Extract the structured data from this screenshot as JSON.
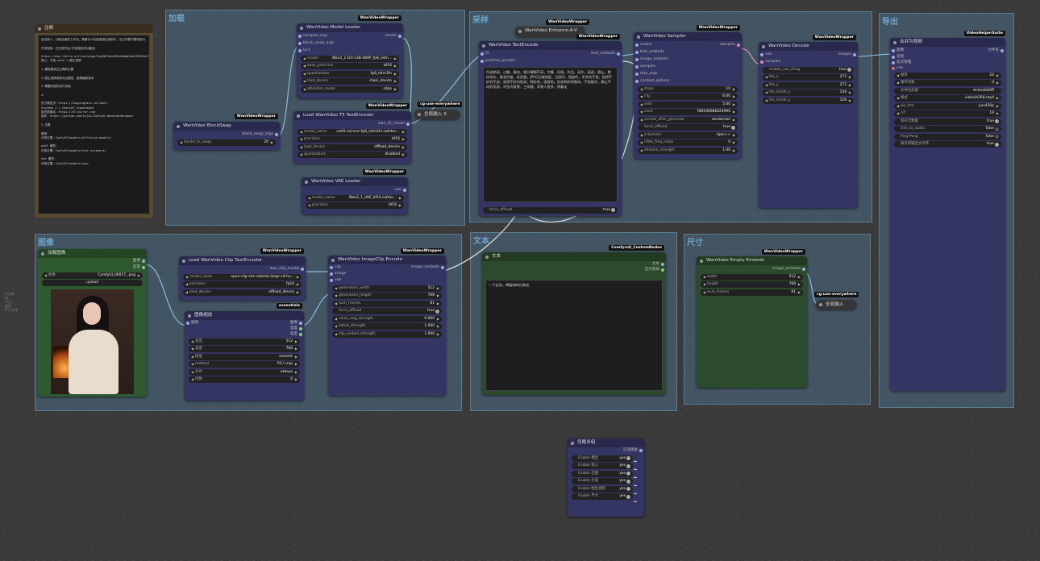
{
  "groups": [
    {
      "id": "g1",
      "title": "加载"
    },
    {
      "id": "g2",
      "title": "采样"
    },
    {
      "id": "g3",
      "title": "图像"
    },
    {
      "id": "g4",
      "title": "文本"
    },
    {
      "id": "g5",
      "title": "尺寸"
    },
    {
      "id": "g6",
      "title": "导出"
    }
  ],
  "note": {
    "title": "注释",
    "text": "适合新人，功能全面的工作流，需要什么功能直接启用即可，自己折叠不要的部分\n\n开关面板：在左侧开启/关闭相应的功能组\n\nhttps://www.liblib.art/userpage/2ad3621ba8934da0ab1bb5935b3d1f5c/publish/workflow\n核心：万相 wan2.1 图生视频\n\n1.模型要放在正确的位置\n\n2.图生视频选择对应模型，都是最新版本\n\n3.需要的插件自行安装\n\n4.\n\n官方模型页：https://huggingface.co/Comfy-Org/Wan_2.1_ComfyUI_repackaged\n国内镜像站：https://hf-mirror.com\n插件：https://github.com/kijai/ComfyUI-WanVideoWrapper\n\n5.位置\n\n模型:\n存放位置：ComfyUI/models/diffusion_models/\n\numt5 模型:\n存放位置：ComfyUI/models/text_encoders/\n\nVae 模型:\n存放位置：ComfyUI/models/vae/"
  },
  "model_loader": {
    "badge": "WanVideoWrapper",
    "title": "WanVideo Model Loader",
    "inputs": [
      "compile_args",
      "block_swap_args",
      "lora"
    ],
    "output": "model",
    "widgets": [
      {
        "label": "model",
        "value": "Wan2_1-I2V-14B-480P_fp8_e4m..."
      },
      {
        "label": "base_precision",
        "value": "bf16"
      },
      {
        "label": "quantization",
        "value": "fp8_e4m3fn"
      },
      {
        "label": "load_device",
        "value": "main_device"
      },
      {
        "label": "attention_mode",
        "value": "sdpa"
      }
    ]
  },
  "block_swap": {
    "badge": "WanVideoWrapper",
    "title": "WanVideo BlockSwap",
    "output": "block_swap_args",
    "widgets": [
      {
        "label": "blocks_to_swap",
        "value": "20"
      }
    ]
  },
  "t5_encoder": {
    "badge": "WanVideoWrapper",
    "title": "Load WanVideo T5 TextEncoder",
    "output": "wan_t5_model",
    "widgets": [
      {
        "label": "model_name",
        "value": "umt5-xxl-enc-fp8_e4m3fn.safeten..."
      },
      {
        "label": "precision",
        "value": "bf16"
      },
      {
        "label": "load_device",
        "value": "offload_device"
      },
      {
        "label": "quantization",
        "value": "disabled"
      }
    ]
  },
  "vae_loader": {
    "badge": "WanVideoWrapper",
    "title": "WanVideo VAE Loader",
    "output": "vae",
    "widgets": [
      {
        "label": "model_name",
        "value": "Wan2_1_VAE_bf16.safete..."
      },
      {
        "label": "precision",
        "value": "bf16"
      }
    ]
  },
  "cg1": {
    "badge": "cg-use-everywhere",
    "title": "全局输入 3"
  },
  "enhance": {
    "badge": "WanVideoWrapper",
    "title": "WanVideo Enhance-A-V"
  },
  "text_encode": {
    "badge": "WanVideoWrapper",
    "title": "WanVideo TextEncode",
    "inputs": [
      "t5",
      "positive_prompt"
    ],
    "output": "text_embeds",
    "prompt": "色调艳丽，过曝，静态，细节模糊不清，字幕，风格，作品，画作，画面，静止，整体发灰，最差质量，低质量，JPEG压缩残留，丑陋的，残缺的，多余的手指，画得不好的手部，画得不好的脸部，畸形的，毁容的，形态畸形的肢体，手指融合，静止不动的画面，杂乱的背景，三条腿，背景人很多，倒着走",
    "widgets": [
      {
        "label": "force_offload",
        "value": "true"
      }
    ]
  },
  "sampler": {
    "badge": "WanVideoWrapper",
    "title": "WanVideo Sampler",
    "inputs": [
      "model",
      "text_embeds",
      "image_embeds",
      "samples",
      "feta_args",
      "context_options"
    ],
    "output": "samples",
    "widgets": [
      {
        "label": "steps",
        "value": "10"
      },
      {
        "label": "cfg",
        "value": "6.00"
      },
      {
        "label": "shift",
        "value": "5.00"
      },
      {
        "label": "seed",
        "value": "789546686624996"
      },
      {
        "label": "control_after_generate",
        "value": "randomize"
      },
      {
        "label": "force_offload",
        "value": "true"
      },
      {
        "label": "scheduler",
        "value": "dpm++"
      },
      {
        "label": "riflex_freq_index",
        "value": "0"
      },
      {
        "label": "denoise_strength",
        "value": "1.00"
      }
    ]
  },
  "decode": {
    "badge": "WanVideoWrapper",
    "title": "WanVideo Decode",
    "inputs": [
      "vae",
      "samples"
    ],
    "output": "images",
    "widgets": [
      {
        "label": "enable_vae_tiling",
        "value": "true"
      },
      {
        "label": "tile_x",
        "value": "272"
      },
      {
        "label": "tile_y",
        "value": "272"
      },
      {
        "label": "tile_stride_x",
        "value": "144"
      },
      {
        "label": "tile_stride_y",
        "value": "128"
      }
    ]
  },
  "combine": {
    "badge": "VideoHelperSuite",
    "title": "合并为视频",
    "inputs": [
      "图像",
      "音频",
      "批次管理",
      "vae"
    ],
    "output": "文件名",
    "widgets": [
      {
        "label": "帧率",
        "value": "24"
      },
      {
        "label": "循环次数",
        "value": "0"
      },
      {
        "label": "文件名前缀",
        "value": "AnimateDiff"
      },
      {
        "label": "格式",
        "value": "video/h264-mp4"
      },
      {
        "label": "pix_fmt",
        "value": "yuv420p"
      },
      {
        "label": "crf",
        "value": "19"
      },
      {
        "label": "保存元数据",
        "value": "true"
      },
      {
        "label": "trim_to_audio",
        "value": "false"
      },
      {
        "label": "Ping-Pong",
        "value": "false"
      },
      {
        "label": "保存到输出文件夹",
        "value": "true"
      }
    ]
  },
  "load_image": {
    "title": "加载图像",
    "outputs": [
      "图像",
      "遮罩"
    ],
    "widgets": [
      {
        "label": "图像",
        "value": "ComfyUI_00017_.png"
      }
    ],
    "upload": "upload"
  },
  "clip_loader": {
    "badge": "WanVideoWrapper",
    "title": "Load WanVideo Clip TextEncoder",
    "output": "wan_clip_model",
    "widgets": [
      {
        "label": "model_name",
        "value": "open-clip-xlm-roberta-large-vit-hu..."
      },
      {
        "label": "precision",
        "value": "fp16"
      },
      {
        "label": "load_device",
        "value": "offload_device"
      }
    ]
  },
  "resize": {
    "badge": "essentials",
    "title": "图像缩放",
    "input": "图像",
    "outputs": [
      "图像",
      "宽度",
      "高度"
    ],
    "widgets": [
      {
        "label": "宽度",
        "value": "512"
      },
      {
        "label": "高度",
        "value": "768"
      },
      {
        "label": "插值",
        "value": "nearest"
      },
      {
        "label": "method",
        "value": "fill / crop"
      },
      {
        "label": "条件",
        "value": "always"
      },
      {
        "label": "倍数",
        "value": "0"
      }
    ]
  },
  "clip_encode": {
    "badge": "WanVideoWrapper",
    "title": "WanVideo ImageClip Encode",
    "inputs": [
      "clip",
      "image",
      "vae"
    ],
    "output": "image_embeds",
    "widgets": [
      {
        "label": "generation_width",
        "value": "512"
      },
      {
        "label": "generation_height",
        "value": "768"
      },
      {
        "label": "num_frames",
        "value": "81"
      },
      {
        "label": "force_offload",
        "value": "true"
      },
      {
        "label": "noise_aug_strength",
        "value": "0.000"
      },
      {
        "label": "latent_strength",
        "value": "1.000"
      },
      {
        "label": "clip_embed_strength",
        "value": "1.000"
      }
    ]
  },
  "text_node": {
    "badge": "Comfyroll_CustomNodes",
    "title": "文本",
    "outputs": [
      "文本",
      "显示帮助"
    ],
    "text": "一个女孩。喝着咖啡在微笑"
  },
  "empty_embeds": {
    "badge": "WanVideoWrapper",
    "title": "WanVideo Empty Embeds",
    "output": "image_embeds",
    "widgets": [
      {
        "label": "width",
        "value": "512"
      },
      {
        "label": "height",
        "value": "768"
      },
      {
        "label": "num_frames",
        "value": "81"
      }
    ]
  },
  "cg2": {
    "badge": "cg-use-everywhere",
    "title": "全局输入"
  },
  "bypass": {
    "title": "忽略多组",
    "output": "可选连接",
    "widgets": [
      {
        "label": "Enable 模型",
        "value": "yes"
      },
      {
        "label": "Enable 核心",
        "value": "yes"
      },
      {
        "label": "Enable 出图",
        "value": "yes"
      },
      {
        "label": "Enable 文案",
        "value": "yes"
      },
      {
        "label": "Enable 图生视频",
        "value": "yes"
      },
      {
        "label": "Enable 尺寸",
        "value": "yes"
      }
    ]
  },
  "side_note": "节点数\n组\n节点\n链接\nFPS 帧率"
}
